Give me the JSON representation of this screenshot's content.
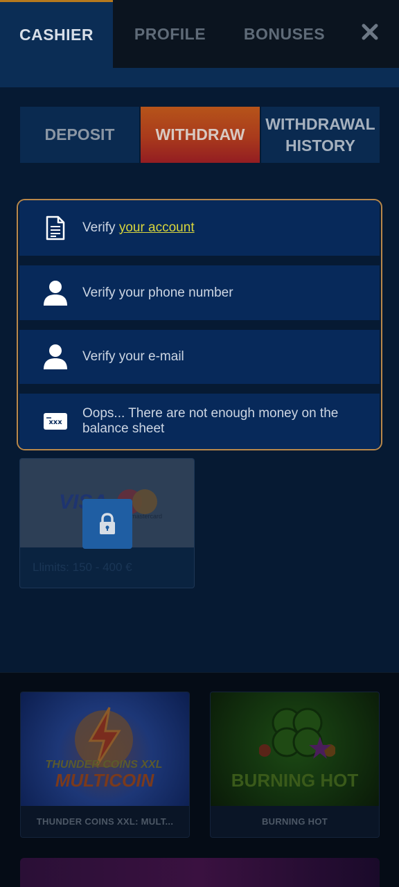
{
  "top_tabs": {
    "cashier": "CASHIER",
    "profile": "PROFILE",
    "bonuses": "BONUSES",
    "close_icon": "close-icon"
  },
  "sub_tabs": {
    "deposit": "DEPOSIT",
    "withdraw": "WITHDRAW",
    "withdrawal_history": "WITHDRAWAL HISTORY",
    "active": "WITHDRAW"
  },
  "verification": {
    "account": {
      "prefix": "Verify ",
      "link": "your account",
      "icon": "document-icon"
    },
    "phone": {
      "text": "Verify your phone number",
      "icon": "user-icon"
    },
    "email": {
      "text": "Verify your e-mail",
      "icon": "user-icon"
    },
    "balance": {
      "text": "Oops... There are not enough money on the balance sheet",
      "icon": "card-xxx-icon"
    }
  },
  "payment_method": {
    "brand_visa": "VISA",
    "brand_mc": "mastercard",
    "limits": "Llimits: 150 - 400 €",
    "locked": true,
    "lock_icon": "lock-icon"
  },
  "games": [
    {
      "title": "THUNDER COINS XXL: MULT...",
      "logo_line1": "THUNDER COINS XXL",
      "logo_line2": "MULTICOIN"
    },
    {
      "title": "BURNING HOT",
      "logo_line1": "BURNING HOT"
    }
  ],
  "colors": {
    "active_tab_gradient_start": "#b6541a",
    "active_tab_gradient_end": "#931d22",
    "card_border": "#b9884a",
    "link": "#d9d63c"
  }
}
